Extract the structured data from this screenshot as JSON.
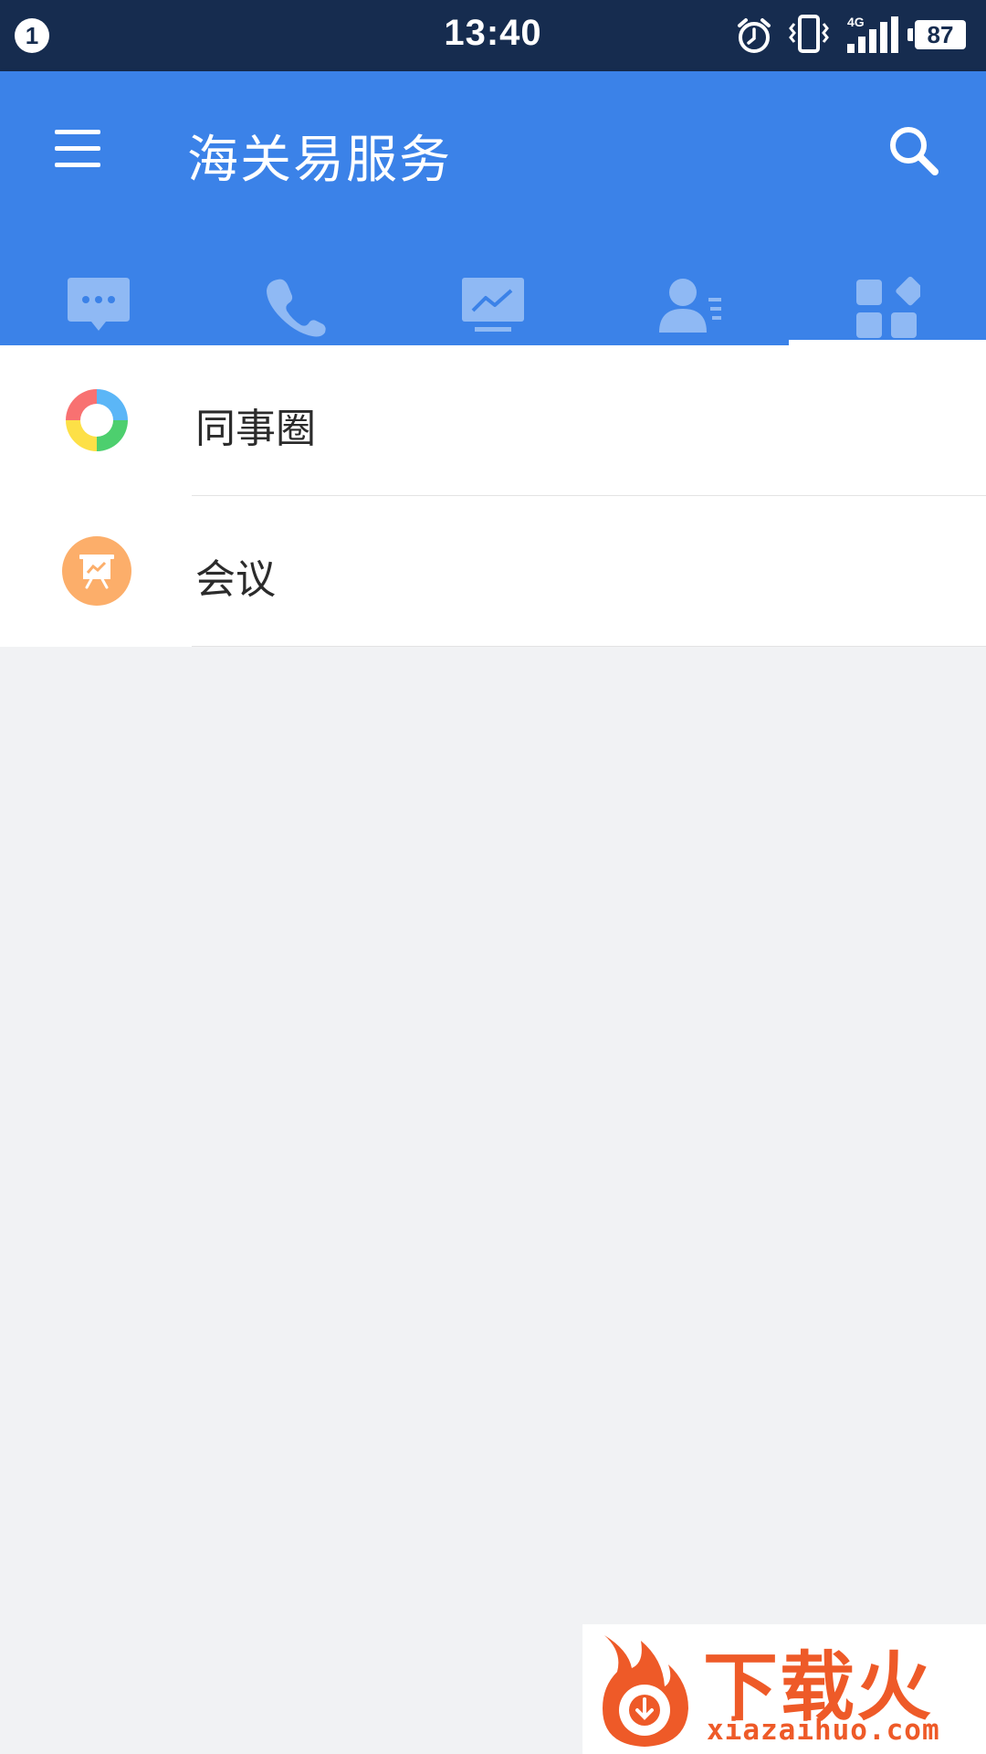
{
  "status_bar": {
    "notification_count": "1",
    "time": "13:40",
    "network": "4G",
    "battery": "87",
    "icons": [
      "alarm-icon",
      "vibrate-icon",
      "signal-icon",
      "battery-icon"
    ]
  },
  "app_bar": {
    "title": "海关易服务",
    "menu_icon": "hamburger-icon",
    "search_icon": "search-icon",
    "color": "#3b82e8"
  },
  "tabs": [
    {
      "icon": "chat-icon",
      "selected": false
    },
    {
      "icon": "phone-icon",
      "selected": false
    },
    {
      "icon": "monitor-chart-icon",
      "selected": false
    },
    {
      "icon": "contacts-icon",
      "selected": false
    },
    {
      "icon": "apps-grid-icon",
      "selected": true
    }
  ],
  "list": {
    "items": [
      {
        "label": "同事圈",
        "icon": "colleague-circle-icon"
      },
      {
        "label": "会议",
        "icon": "meeting-icon"
      }
    ]
  },
  "watermark": {
    "title": "下载火",
    "url": "xiazaihuo.com",
    "accent": "#ee5a28"
  }
}
